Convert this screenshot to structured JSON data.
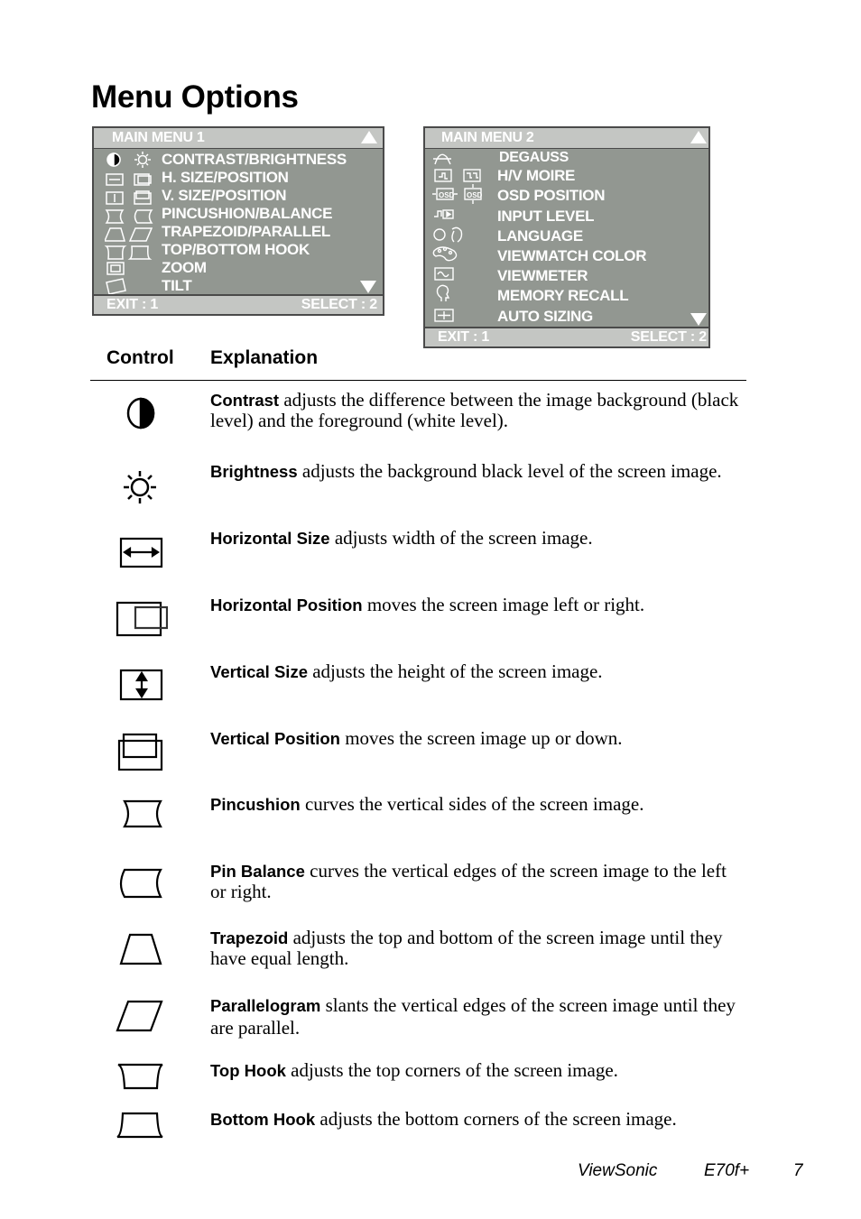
{
  "page": {
    "title": "Menu Options"
  },
  "menu1": {
    "header": "MAIN MENU 1",
    "items": [
      {
        "label": "CONTRAST/BRIGHTNESS",
        "icons": [
          "contrast-icon",
          "brightness-icon"
        ]
      },
      {
        "label": "H. SIZE/POSITION",
        "icons": [
          "horizontal-size-icon",
          "horizontal-position-icon"
        ]
      },
      {
        "label": "V. SIZE/POSITION",
        "icons": [
          "vertical-size-icon",
          "vertical-position-icon"
        ]
      },
      {
        "label": "PINCUSHION/BALANCE",
        "icons": [
          "pincushion-icon",
          "pin-balance-icon"
        ]
      },
      {
        "label": "TRAPEZOID/PARALLEL",
        "icons": [
          "trapezoid-icon",
          "parallelogram-icon"
        ]
      },
      {
        "label": "TOP/BOTTOM HOOK",
        "icons": [
          "top-hook-icon",
          "bottom-hook-icon"
        ]
      },
      {
        "label": "ZOOM",
        "icons": [
          "zoom-icon"
        ]
      },
      {
        "label": "TILT",
        "icons": [
          "tilt-icon"
        ]
      }
    ],
    "exit": "EXIT : 1",
    "select": "SELECT : 2"
  },
  "menu2": {
    "header": "MAIN MENU 2",
    "items": [
      {
        "label": "DEGAUSS",
        "icons": [
          "degauss-icon"
        ]
      },
      {
        "label": "H/V MOIRE",
        "icons": [
          "h-moire-icon",
          "v-moire-icon"
        ]
      },
      {
        "label": "OSD POSITION",
        "icons": [
          "osd-h-position-icon",
          "osd-v-position-icon"
        ]
      },
      {
        "label": "INPUT LEVEL",
        "icons": [
          "input-level-icon"
        ]
      },
      {
        "label": "LANGUAGE",
        "icons": [
          "language-icon"
        ]
      },
      {
        "label": "VIEWMATCH COLOR",
        "icons": [
          "viewmatch-color-icon"
        ]
      },
      {
        "label": "VIEWMETER",
        "icons": [
          "viewmeter-icon"
        ]
      },
      {
        "label": "MEMORY RECALL",
        "icons": [
          "memory-recall-icon"
        ]
      },
      {
        "label": "AUTO SIZING",
        "icons": [
          "auto-sizing-icon"
        ]
      }
    ],
    "exit": "EXIT : 1",
    "select": "SELECT : 2"
  },
  "table": {
    "col_control": "Control",
    "col_explanation": "Explanation",
    "rows": [
      {
        "icon": "contrast-icon",
        "term": "Contrast",
        "text": " adjusts the difference between the image background (black level) and the foreground (white level)."
      },
      {
        "icon": "brightness-icon",
        "term": "Brightness",
        "text": " adjusts the background black level of the screen image."
      },
      {
        "icon": "horizontal-size-icon",
        "term": "Horizontal Size",
        "text": " adjusts width of the screen image."
      },
      {
        "icon": "horizontal-position-icon",
        "term": "Horizontal Position",
        "text": " moves the screen image left or right."
      },
      {
        "icon": "vertical-size-icon",
        "term": "Vertical Size",
        "text": " adjusts the height of the screen image."
      },
      {
        "icon": "vertical-position-icon",
        "term": "Vertical Position",
        "text": " moves the screen image up or down."
      },
      {
        "icon": "pincushion-icon",
        "term": "Pincushion",
        "text": " curves the vertical sides of the screen image."
      },
      {
        "icon": "pin-balance-icon",
        "term": "Pin Balance",
        "text": " curves the vertical edges of the screen image to the left or right."
      },
      {
        "icon": "trapezoid-icon",
        "term": "Trapezoid",
        "text": " adjusts the top and bottom of the screen image until they have equal length."
      },
      {
        "icon": "parallelogram-icon",
        "term": "Parallelogram",
        "text": " slants the vertical edges of the screen image until they are parallel."
      },
      {
        "icon": "top-hook-icon",
        "term": "Top Hook",
        "text": " adjusts the top corners of the screen image."
      },
      {
        "icon": "bottom-hook-icon",
        "term": "Bottom Hook",
        "text": " adjusts the bottom corners of the screen image."
      }
    ]
  },
  "footer": {
    "brand": "ViewSonic",
    "model": "E70f+",
    "page_number": "7"
  }
}
